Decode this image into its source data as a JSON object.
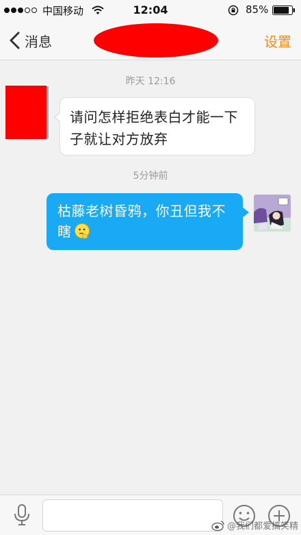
{
  "status_bar": {
    "carrier": "中国移动",
    "time": "12:04",
    "battery_percent": "85%",
    "signal_bars_filled": 3,
    "signal_bars_total": 5,
    "battery_level": 0.85
  },
  "nav": {
    "back_label": "消息",
    "settings_label": "设置",
    "title_redaction_color": "#ff0000",
    "accent_color": "#f28c1f"
  },
  "chat": {
    "timestamp_1": "昨天 12:16",
    "message_incoming": "请问怎样拒绝表白才能一下子就让对方放弃",
    "timestamp_2": "5分钟前",
    "message_outgoing": "枯藤老树昏鸦，你丑但我不瞎",
    "outgoing_emoji": "thinking-face-emoji",
    "outgoing_bubble_color": "#1aa9f5"
  },
  "input_bar": {
    "value": "",
    "placeholder": "",
    "icons": [
      "microphone-icon",
      "smiley-icon",
      "plus-icon"
    ]
  },
  "watermark": {
    "text": "@我们都爱搞笑精"
  }
}
